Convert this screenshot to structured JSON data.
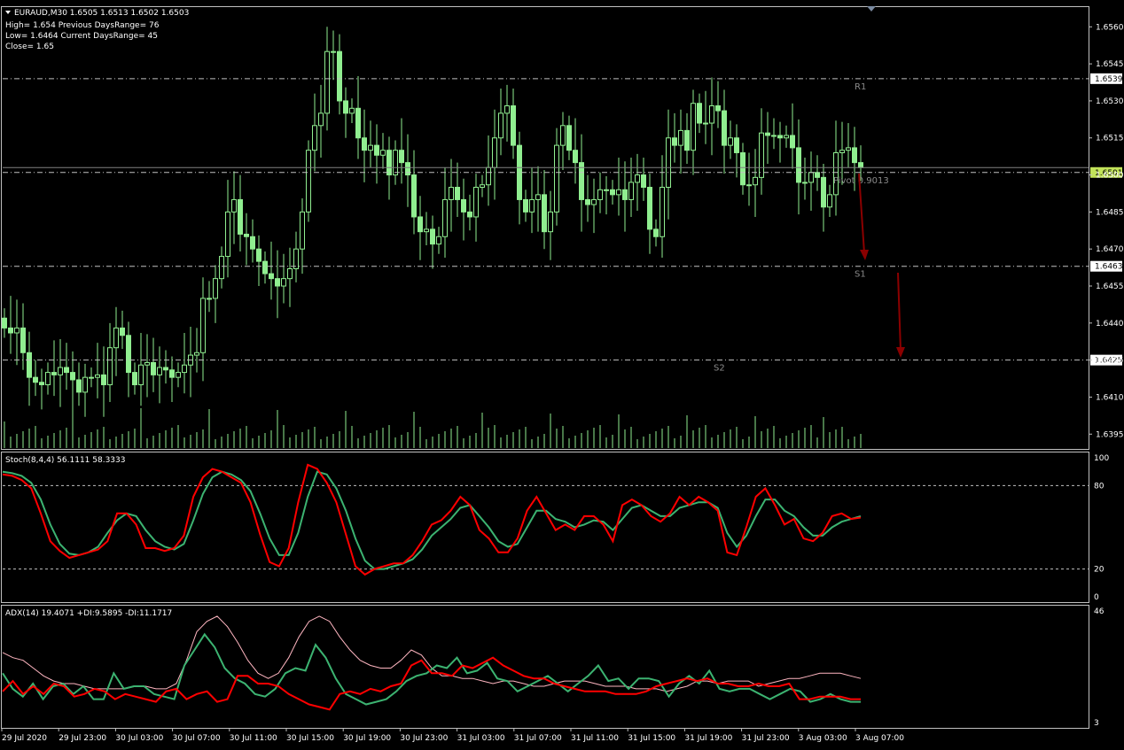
{
  "header": {
    "symbol_line": "EURAUD,M30  1.6505 1.6513 1.6502 1.6503",
    "high_line": "High= 1.654 Previous DaysRange= 76",
    "low_line": "Low= 1.6464 Current DaysRange= 45",
    "close_line": "Close= 1.65"
  },
  "colors": {
    "background": "#000000",
    "grid": "#c0c0c0",
    "candle": "#90ee90",
    "current_price_bg": "#c2e35a",
    "stoch_main": "#ff0000",
    "stoch_signal": "#3cb371",
    "adx_line": "#ffb6c1",
    "plus_di": "#3cb371",
    "minus_di": "#ff0000",
    "arrow": "#8b0000"
  },
  "chart_data": [
    {
      "type": "candlestick",
      "symbol": "EURAUD",
      "timeframe": "M30",
      "ylim": [
        1.6389,
        1.6568
      ],
      "y_ticks": [
        "1.6560",
        "1.6545",
        "1.6530",
        "1.6515",
        "1.6500",
        "1.6485",
        "1.6470",
        "1.6455",
        "1.6440",
        "1.6425",
        "1.6410",
        "1.6395"
      ],
      "x_ticks": [
        "29 Jul 2020",
        "29 Jul 23:00",
        "30 Jul 03:00",
        "30 Jul 07:00",
        "30 Jul 11:00",
        "30 Jul 15:00",
        "30 Jul 19:00",
        "30 Jul 23:00",
        "31 Jul 03:00",
        "31 Jul 07:00",
        "31 Jul 11:00",
        "31 Jul 15:00",
        "31 Jul 19:00",
        "31 Jul 23:00",
        "3 Aug 03:00",
        "3 Aug 07:00"
      ],
      "levels": [
        {
          "label": "R1",
          "price": 1.6539,
          "tag": "1.6539"
        },
        {
          "label": "Pivot 0.9013",
          "price": 1.6501,
          "tag": "1.6501"
        },
        {
          "label": "S1",
          "price": 1.6463,
          "tag": "1.6463"
        },
        {
          "label": "S2",
          "price": 1.6425,
          "tag": "1.6425"
        }
      ],
      "current_price": 1.6503,
      "closes": [
        1.6438,
        1.6436,
        1.6438,
        1.6428,
        1.6418,
        1.6416,
        1.6415,
        1.642,
        1.6419,
        1.6422,
        1.642,
        1.6417,
        1.6412,
        1.6418,
        1.6418,
        1.6419,
        1.6415,
        1.643,
        1.6438,
        1.6435,
        1.642,
        1.6415,
        1.6423,
        1.6424,
        1.6419,
        1.6422,
        1.6421,
        1.6418,
        1.642,
        1.6423,
        1.6427,
        1.6428,
        1.645,
        1.645,
        1.6458,
        1.6467,
        1.6485,
        1.649,
        1.6476,
        1.6475,
        1.647,
        1.6465,
        1.646,
        1.6458,
        1.6455,
        1.6458,
        1.6462,
        1.647,
        1.6485,
        1.651,
        1.652,
        1.6525,
        1.655,
        1.655,
        1.653,
        1.6525,
        1.6527,
        1.6515,
        1.651,
        1.6512,
        1.6508,
        1.651,
        1.65,
        1.651,
        1.6505,
        1.65,
        1.6483,
        1.6477,
        1.6478,
        1.6472,
        1.6475,
        1.649,
        1.6495,
        1.649,
        1.6485,
        1.6483,
        1.6495,
        1.6496,
        1.6503,
        1.6515,
        1.6525,
        1.6528,
        1.6512,
        1.649,
        1.6485,
        1.649,
        1.6492,
        1.6477,
        1.6485,
        1.6512,
        1.652,
        1.651,
        1.6505,
        1.649,
        1.6488,
        1.649,
        1.6494,
        1.6494,
        1.6492,
        1.6494,
        1.649,
        1.6497,
        1.65,
        1.6495,
        1.6478,
        1.6475,
        1.6495,
        1.6515,
        1.6512,
        1.6518,
        1.651,
        1.6529,
        1.6521,
        1.6521,
        1.6528,
        1.6526,
        1.6512,
        1.6515,
        1.6509,
        1.6496,
        1.6496,
        1.6499,
        1.6517,
        1.6516,
        1.6516,
        1.6515,
        1.6516,
        1.6511,
        1.6497,
        1.6497,
        1.6501,
        1.6499,
        1.6487,
        1.6492,
        1.6509,
        1.651,
        1.6511,
        1.6505,
        1.6503
      ],
      "volume_shown": true
    },
    {
      "type": "line",
      "title": "Stoch(8,4,4) 56.1111 58.3333",
      "ylim": [
        0,
        100
      ],
      "levels": [
        80,
        20
      ],
      "y_ticks": [
        "100",
        "80",
        "20",
        "0"
      ],
      "series": [
        {
          "name": "main",
          "values": [
            88,
            87,
            84,
            78,
            60,
            40,
            33,
            28,
            30,
            32,
            34,
            40,
            60,
            60,
            52,
            35,
            35,
            33,
            35,
            44,
            72,
            86,
            92,
            90,
            86,
            82,
            68,
            45,
            25,
            22,
            35,
            68,
            95,
            92,
            82,
            68,
            45,
            22,
            16,
            20,
            22,
            24,
            24,
            30,
            40,
            52,
            55,
            62,
            72,
            66,
            48,
            42,
            32,
            32,
            42,
            62,
            72,
            60,
            48,
            52,
            48,
            58,
            58,
            52,
            40,
            66,
            70,
            66,
            58,
            54,
            60,
            72,
            66,
            72,
            68,
            62,
            32,
            30,
            50,
            72,
            78,
            66,
            52,
            56,
            42,
            40,
            46,
            58,
            60,
            56,
            57
          ]
        },
        {
          "name": "signal",
          "values": [
            90,
            89,
            87,
            82,
            70,
            52,
            38,
            31,
            30,
            32,
            36,
            46,
            55,
            60,
            58,
            48,
            40,
            36,
            34,
            38,
            55,
            74,
            86,
            90,
            88,
            84,
            76,
            60,
            42,
            30,
            30,
            46,
            72,
            90,
            88,
            78,
            62,
            42,
            26,
            20,
            20,
            22,
            24,
            27,
            34,
            44,
            50,
            56,
            64,
            66,
            58,
            50,
            40,
            36,
            38,
            50,
            62,
            62,
            56,
            54,
            50,
            52,
            55,
            54,
            48,
            56,
            64,
            66,
            62,
            58,
            58,
            64,
            66,
            68,
            68,
            64,
            46,
            36,
            44,
            58,
            70,
            70,
            62,
            58,
            50,
            44,
            44,
            50,
            54,
            56,
            58
          ]
        }
      ]
    },
    {
      "type": "line",
      "title": "ADX(14) 19.4071 +DI:9.5895 -DI:11.1717",
      "ylim": [
        3,
        46
      ],
      "y_ticks": [
        "46",
        "3"
      ],
      "series": [
        {
          "name": "ADX",
          "values": [
            30,
            28,
            27,
            24,
            21,
            19,
            18,
            18,
            17,
            16,
            16,
            16,
            16,
            17,
            17,
            16,
            16,
            18,
            27,
            38,
            42,
            44,
            40,
            34,
            27,
            22,
            20,
            22,
            28,
            36,
            42,
            44,
            42,
            36,
            31,
            27,
            25,
            24,
            24,
            27,
            31,
            29,
            24,
            21,
            21,
            20,
            20,
            19,
            18,
            19,
            19,
            18,
            17,
            17,
            18,
            19,
            19,
            19,
            18,
            17,
            17,
            17,
            16,
            16,
            16,
            15,
            16,
            17,
            19,
            19,
            18,
            19,
            19,
            19,
            17,
            18,
            19,
            20,
            20,
            21,
            22,
            22,
            22,
            21,
            20
          ]
        },
        {
          "name": "+DI",
          "values": [
            22,
            16,
            13,
            18,
            12,
            17,
            18,
            14,
            17,
            12,
            12,
            22,
            16,
            17,
            17,
            14,
            13,
            12,
            25,
            31,
            37,
            32,
            24,
            20,
            18,
            14,
            13,
            16,
            22,
            24,
            23,
            33,
            28,
            20,
            14,
            12,
            10,
            11,
            12,
            15,
            19,
            21,
            22,
            25,
            24,
            28,
            22,
            23,
            26,
            20,
            19,
            15,
            17,
            19,
            21,
            18,
            15,
            18,
            21,
            25,
            19,
            20,
            16,
            20,
            20,
            19,
            13,
            18,
            21,
            18,
            23,
            16,
            15,
            16,
            16,
            14,
            12,
            14,
            16,
            15,
            11,
            12,
            14,
            12,
            11,
            11
          ]
        },
        {
          "name": "-DI",
          "values": [
            15,
            19,
            14,
            17,
            14,
            18,
            17,
            13,
            14,
            16,
            15,
            12,
            14,
            13,
            12,
            11,
            15,
            16,
            12,
            14,
            15,
            11,
            12,
            21,
            21,
            18,
            18,
            17,
            14,
            12,
            10,
            9,
            8,
            14,
            15,
            14,
            16,
            15,
            17,
            18,
            25,
            27,
            22,
            22,
            21,
            25,
            24,
            26,
            28,
            25,
            23,
            21,
            20,
            20,
            18,
            17,
            16,
            15,
            15,
            15,
            14,
            14,
            14,
            15,
            17,
            18,
            19,
            20,
            19,
            20,
            18,
            18,
            17,
            17,
            18,
            17,
            17,
            18,
            12,
            12,
            13,
            13,
            13,
            12,
            12
          ]
        }
      ]
    }
  ]
}
